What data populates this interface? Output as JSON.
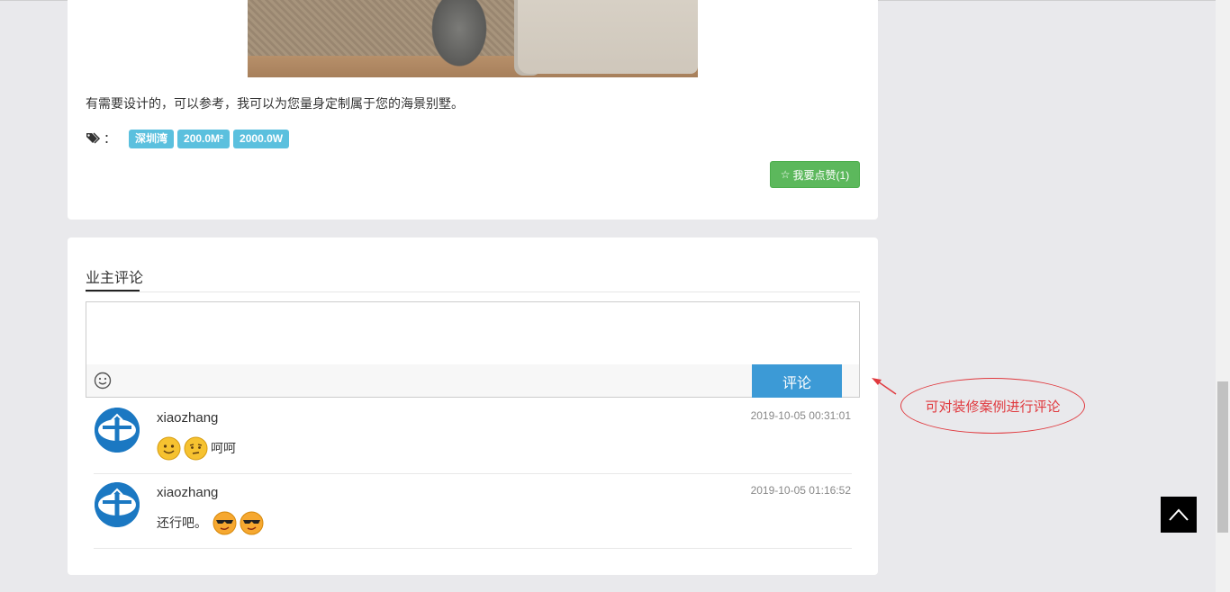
{
  "post": {
    "description": "有需要设计的，可以参考，我可以为您量身定制属于您的海景别墅。",
    "tags_separator": "：",
    "tags": [
      "深圳湾",
      "200.0M²",
      "2000.0W"
    ],
    "like_label": "我要点赞(1)"
  },
  "comments_section": {
    "title": "业主评论",
    "textarea_placeholder": "",
    "submit_label": "评论",
    "comments": [
      {
        "username": "xiaozhang",
        "time": "2019-10-05 00:31:01",
        "text": "呵呵",
        "emojis": [
          "smile-emoji",
          "thinking-emoji"
        ]
      },
      {
        "username": "xiaozhang",
        "time": "2019-10-05 01:16:52",
        "text": "还行吧。",
        "emojis": [
          "cool-emoji",
          "cool-emoji"
        ]
      }
    ]
  },
  "annotation": {
    "text": "可对装修案例进行评论",
    "color": "#e0393e"
  },
  "colors": {
    "tag": "#5bc0de",
    "like_button": "#5cb85c",
    "submit_button": "#3c9ad6",
    "avatar": "#1b78c2"
  }
}
